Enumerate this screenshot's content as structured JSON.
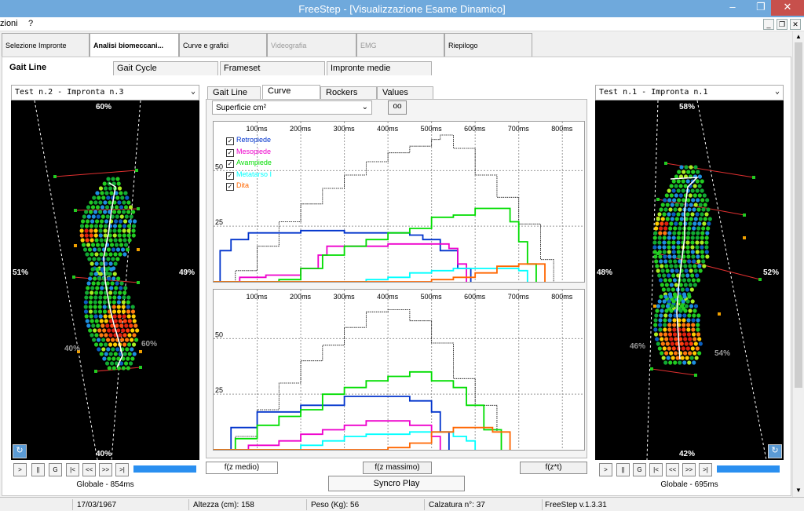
{
  "window": {
    "title": "FreeStep - [Visualizzazione Esame Dinamico]",
    "menu": [
      "zioni",
      "?"
    ]
  },
  "main_tabs": [
    {
      "label": "Selezione Impronte",
      "state": "normal"
    },
    {
      "label": "Analisi biomeccani...",
      "state": "active"
    },
    {
      "label": "Curve e grafici",
      "state": "normal"
    },
    {
      "label": "Videografia",
      "state": "disabled"
    },
    {
      "label": "EMG",
      "state": "disabled"
    },
    {
      "label": "Riepilogo",
      "state": "normal"
    }
  ],
  "sub_tabs": [
    "Gait Line",
    "Gait Cycle",
    "Frameset",
    "Impronte medie"
  ],
  "left_panel": {
    "selector": "Test n.2 - Impronta n.3",
    "top_pct": "60%",
    "left_pct": "51%",
    "right_pct": "49%",
    "heel_left_pct": "40%",
    "heel_right_pct": "60%",
    "bottom_pct": "40%",
    "status": "Globale - 854ms",
    "progress": 1.0
  },
  "right_panel": {
    "selector": "Test n.1 - Impronta n.1",
    "top_pct": "58%",
    "left_pct": "48%",
    "right_pct": "52%",
    "heel_left_pct": "46%",
    "heel_right_pct": "54%",
    "bottom_pct": "42%",
    "status": "Globale - 695ms",
    "progress": 1.0
  },
  "playback": [
    ">",
    "||",
    "G",
    "|<",
    "<<",
    ">>",
    ">|"
  ],
  "center": {
    "tabs": [
      "Gait Line",
      "Curve",
      "Rockers",
      "Values"
    ],
    "active_tab": "Curve",
    "measure": "Superficie cm²",
    "oo_button": "oo",
    "buttons": {
      "medio": "f(z medio)",
      "massimo": "f(z massimo)",
      "zt": "f(z*t)",
      "syncro": "Syncro Play"
    }
  },
  "chart_data": [
    {
      "type": "line",
      "x_unit": "ms",
      "x_ticks": [
        "100ms",
        "200ms",
        "300ms",
        "400ms",
        "500ms",
        "600ms",
        "700ms",
        "800ms"
      ],
      "y_ticks": [
        "25",
        "50"
      ],
      "xlim": [
        0,
        850
      ],
      "ylim": [
        0,
        72
      ],
      "series": [
        {
          "name": "",
          "color": "#000000",
          "style": "dotted",
          "x": [
            0,
            50,
            100,
            150,
            200,
            250,
            300,
            350,
            400,
            450,
            500,
            520,
            550,
            600,
            650,
            700,
            750,
            780
          ],
          "y": [
            0,
            5,
            16,
            27,
            35,
            42,
            48,
            54,
            58,
            61,
            64,
            66,
            60,
            48,
            38,
            26,
            10,
            0
          ]
        },
        {
          "name": "Retropiede",
          "color": "#0033cc",
          "x": [
            0,
            15,
            40,
            80,
            120,
            200,
            300,
            400,
            450,
            480,
            520,
            560,
            590
          ],
          "y": [
            0,
            14,
            19,
            22,
            22,
            23,
            22,
            22,
            21,
            19,
            14,
            6,
            0
          ]
        },
        {
          "name": "Mesopiede",
          "color": "#ee00cc",
          "x": [
            0,
            60,
            120,
            160,
            200,
            240,
            260,
            300,
            400,
            500,
            540,
            560,
            580
          ],
          "y": [
            0,
            2,
            3,
            3,
            6,
            12,
            16,
            16,
            17,
            17,
            15,
            8,
            0
          ]
        },
        {
          "name": "Avampiede",
          "color": "#00dd00",
          "x": [
            0,
            150,
            200,
            250,
            300,
            350,
            400,
            450,
            500,
            550,
            600,
            650,
            680,
            700,
            720,
            740
          ],
          "y": [
            0,
            1,
            6,
            12,
            16,
            19,
            22,
            24,
            29,
            30,
            33,
            33,
            27,
            18,
            8,
            0
          ]
        },
        {
          "name": "Metatarso I",
          "color": "#00ffff",
          "x": [
            0,
            350,
            400,
            450,
            500,
            550,
            600,
            650,
            700,
            720
          ],
          "y": [
            0,
            1,
            2,
            4,
            5,
            6,
            6,
            6,
            5,
            0
          ]
        },
        {
          "name": "Dita",
          "color": "#ff6600",
          "x": [
            0,
            500,
            550,
            600,
            650,
            700,
            730,
            760
          ],
          "y": [
            0,
            1,
            2,
            4,
            7,
            8,
            8,
            0
          ]
        }
      ]
    },
    {
      "type": "line",
      "x_unit": "ms",
      "x_ticks": [
        "100ms",
        "200ms",
        "300ms",
        "400ms",
        "500ms",
        "600ms",
        "700ms",
        "800ms"
      ],
      "y_ticks": [
        "25",
        "50"
      ],
      "xlim": [
        0,
        850
      ],
      "ylim": [
        0,
        72
      ],
      "series": [
        {
          "name": "",
          "color": "#000000",
          "style": "dotted",
          "x": [
            0,
            50,
            100,
            150,
            200,
            250,
            300,
            350,
            400,
            450,
            500,
            550,
            600,
            650,
            680
          ],
          "y": [
            0,
            6,
            18,
            30,
            40,
            47,
            55,
            62,
            63,
            58,
            48,
            32,
            20,
            8,
            0
          ]
        },
        {
          "name": "",
          "color": "#0033cc",
          "x": [
            0,
            40,
            100,
            200,
            300,
            350,
            400,
            450,
            500,
            520,
            540
          ],
          "y": [
            0,
            10,
            17,
            20,
            24,
            24,
            24,
            22,
            17,
            8,
            0
          ]
        },
        {
          "name": "",
          "color": "#ee00cc",
          "x": [
            0,
            80,
            150,
            200,
            250,
            300,
            350,
            400,
            450,
            500,
            520
          ],
          "y": [
            0,
            2,
            4,
            7,
            9,
            11,
            13,
            13,
            11,
            6,
            0
          ]
        },
        {
          "name": "",
          "color": "#00dd00",
          "x": [
            0,
            50,
            100,
            150,
            200,
            250,
            300,
            350,
            400,
            450,
            500,
            550,
            580,
            620,
            660
          ],
          "y": [
            0,
            5,
            11,
            15,
            18,
            25,
            28,
            31,
            33,
            35,
            31,
            28,
            20,
            9,
            0
          ]
        },
        {
          "name": "",
          "color": "#00ffff",
          "x": [
            0,
            200,
            250,
            300,
            350,
            400,
            450,
            500,
            550,
            580,
            600
          ],
          "y": [
            0,
            2,
            4,
            6,
            7,
            7,
            8,
            8,
            6,
            4,
            0
          ]
        },
        {
          "name": "",
          "color": "#ff6600",
          "x": [
            0,
            400,
            450,
            500,
            550,
            600,
            640,
            680
          ],
          "y": [
            0,
            1,
            3,
            8,
            10,
            10,
            8,
            0
          ]
        }
      ]
    }
  ],
  "status_bar": {
    "dob": "17/03/1967",
    "altezza": "Altezza (cm): 158",
    "peso": "Peso (Kg): 56",
    "calzatura": "Calzatura n°: 37",
    "version": "FreeStep v.1.3.31"
  }
}
